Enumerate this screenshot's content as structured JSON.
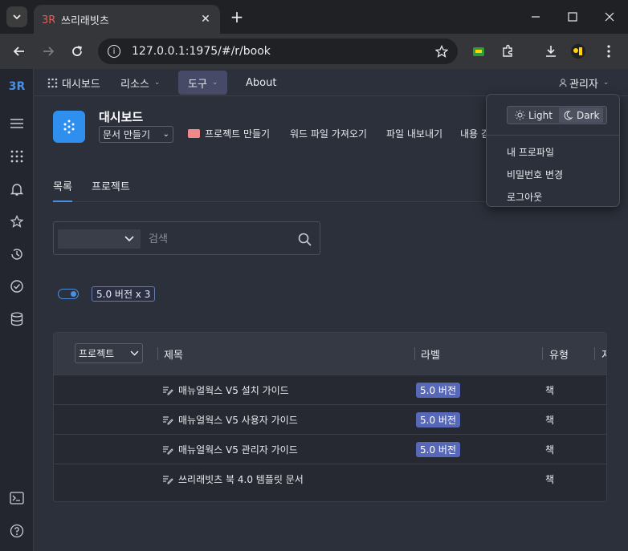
{
  "browser": {
    "tab_title": "쓰리래빗츠",
    "url": "127.0.0.1:1975/#/r/book"
  },
  "app": {
    "logo": "3R",
    "nav": {
      "dashboard": "대시보드",
      "resources": "리소스",
      "tools": "도구",
      "about": "About",
      "user": "관리자"
    },
    "page": {
      "title": "대시보드",
      "doc_select": "문서 만들기",
      "actions": [
        "프로젝트 만들기",
        "워드 파일 가져오기",
        "파일 내보내기",
        "내용 검"
      ]
    },
    "tabs": [
      "목록",
      "프로젝트"
    ],
    "search": {
      "placeholder": "검색"
    },
    "filter_chip": "5.0 버전 x 3",
    "table": {
      "project_select": "프로젝트",
      "columns": [
        "제목",
        "라벨",
        "유형",
        "저"
      ],
      "rows": [
        {
          "title": "매뉴얼웍스 V5 설치 가이드",
          "label": "5.0 버전",
          "type": "책"
        },
        {
          "title": "매뉴얼웍스 V5 사용자 가이드",
          "label": "5.0 버전",
          "type": "책"
        },
        {
          "title": "매뉴얼웍스 V5 관리자 가이드",
          "label": "5.0 버전",
          "type": "책"
        },
        {
          "title": "쓰리래빗츠 북 4.0 템플릿 문서",
          "label": "",
          "type": "책"
        }
      ]
    },
    "menu": {
      "light": "Light",
      "dark": "Dark",
      "profile": "내 프로파일",
      "change_password": "비밀번호 변경",
      "logout": "로그아웃"
    }
  },
  "colors": {
    "accent": "#4a8fe0",
    "label_badge": "#5868b8",
    "page_icon": "#2f8fef"
  }
}
